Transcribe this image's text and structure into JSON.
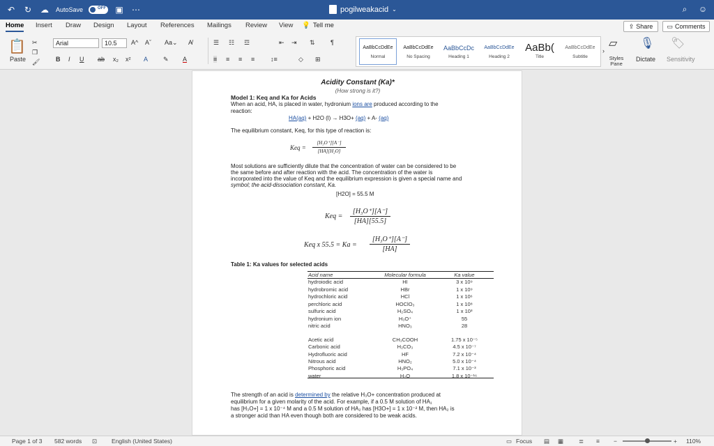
{
  "titlebar": {
    "autosave_label": "AutoSave",
    "autosave_state": "OFF",
    "doc_name": "pogilweakacid"
  },
  "tabs": [
    "Home",
    "Insert",
    "Draw",
    "Design",
    "Layout",
    "References",
    "Mailings",
    "Review",
    "View"
  ],
  "tell_me": "Tell me",
  "share": "Share",
  "comments": "Comments",
  "ribbon": {
    "paste": "Paste",
    "font": "Arial",
    "size": "10.5",
    "dictate": "Dictate",
    "sensitivity": "Sensitivity",
    "styles_pane": "Styles Pane"
  },
  "styles": [
    {
      "sample": "AaBbCcDdEe",
      "name": "Normal"
    },
    {
      "sample": "AaBbCcDdEe",
      "name": "No Spacing"
    },
    {
      "sample": "AaBbCcDc",
      "name": "Heading 1"
    },
    {
      "sample": "AaBbCcDdEe",
      "name": "Heading 2"
    },
    {
      "sample": "AaBb(",
      "name": "Title"
    },
    {
      "sample": "AaBbCcDdEe",
      "name": "Subtitle"
    }
  ],
  "doc": {
    "title": "Acidity Constant (Ka)*",
    "subtitle": "(How strong is it?)",
    "model_heading": "Model 1: Keq and Ka for Acids",
    "p1a": "When an acid, HA, is placed in water, hydronium ",
    "p1_link": "ions are",
    "p1b": " produced according to the",
    "p1c": "reaction:",
    "reaction_a": "HA(aq)",
    "reaction_b": " + H2O (l) → H3O+ ",
    "reaction_c": "(aq)",
    "reaction_d": " + A- ",
    "reaction_e": "(aq)",
    "p2": "The equilibrium constant, Keq, for this type of reaction is:",
    "keq_lhs": "Keq =",
    "keq_num": "[H₃O⁺][A⁻]",
    "keq_den": "[HA][H₂O]",
    "p3_1": "Most solutions are sufficiently dilute that the concentration of water can be considered to be",
    "p3_2": "the same before and after reaction with the acid. The concentration of the water is",
    "p3_3": "incorporated into the value of Keq and the equilibrium expression is given a special name and",
    "p3_4": "symbol; the acid-dissociation constant, Ka.",
    "h2o_conc": "[H2O] = 55.5 M",
    "eq2_lhs": "Keq =",
    "eq2_num": "[H₃O⁺][A⁻]",
    "eq2_den": "[HA][55.5]",
    "eq3_lhs": "Keq x 55.5 = Ka =",
    "eq3_num": "[H₃O⁺][A⁻]",
    "eq3_den": "[HA]",
    "table_caption": "Table 1: Ka values for selected acids",
    "table_headers": [
      "Acid name",
      "Molecular formula",
      "Ka value"
    ],
    "strong_rows": [
      [
        "hydroiodic acid",
        "HI",
        "3 x 10⁹"
      ],
      [
        "hydrobromic acid",
        "HBr",
        "1 x 10⁹"
      ],
      [
        "hydrochloric acid",
        "HCl",
        "1 x 10⁶"
      ],
      [
        "perchloric acid",
        "HOClO₃",
        "1 x 10⁸"
      ],
      [
        "sulfuric acid",
        "H₂SO₄",
        "1 x 10³"
      ],
      [
        "hydronium ion",
        "H₃O⁺",
        "55"
      ],
      [
        "nitric acid",
        "HNO₃",
        "28"
      ]
    ],
    "weak_rows": [
      [
        "Acetic acid",
        "CH₃COOH",
        "1.75 x 10⁻⁵"
      ],
      [
        "Carbonic acid",
        "H₂CO₃",
        "4.5 x 10⁻⁷"
      ],
      [
        "Hydrofluoric acid",
        "HF",
        "7.2 x 10⁻⁴"
      ],
      [
        "Nitrous acid",
        "HNO₂",
        "5.0 x 10⁻⁴"
      ],
      [
        "Phosphoric acid",
        "H₃PO₄",
        "7.1 x 10⁻³"
      ],
      [
        "water",
        "H₂O",
        "1.8 x 10⁻¹⁶"
      ]
    ],
    "p4_1a": "The strength of an acid is ",
    "p4_1_link": "determined by",
    "p4_1b": " the relative H₃O+ concentration produced at",
    "p4_2": "equilibrium for a given molarity of the acid. For example, if a 0.5 M solution of HA₁",
    "p4_3": "has [H₃O+] = 1 x 10⁻⁴ M and a 0.5 M solution of HA₂ has [H3O+] = 1 x 10⁻² M, then HA₂ is",
    "p4_4": "a stronger acid than HA even though both are considered to be weak acids."
  },
  "status": {
    "page": "Page 1 of 3",
    "words": "582 words",
    "language": "English (United States)",
    "focus": "Focus",
    "zoom": "110%"
  }
}
